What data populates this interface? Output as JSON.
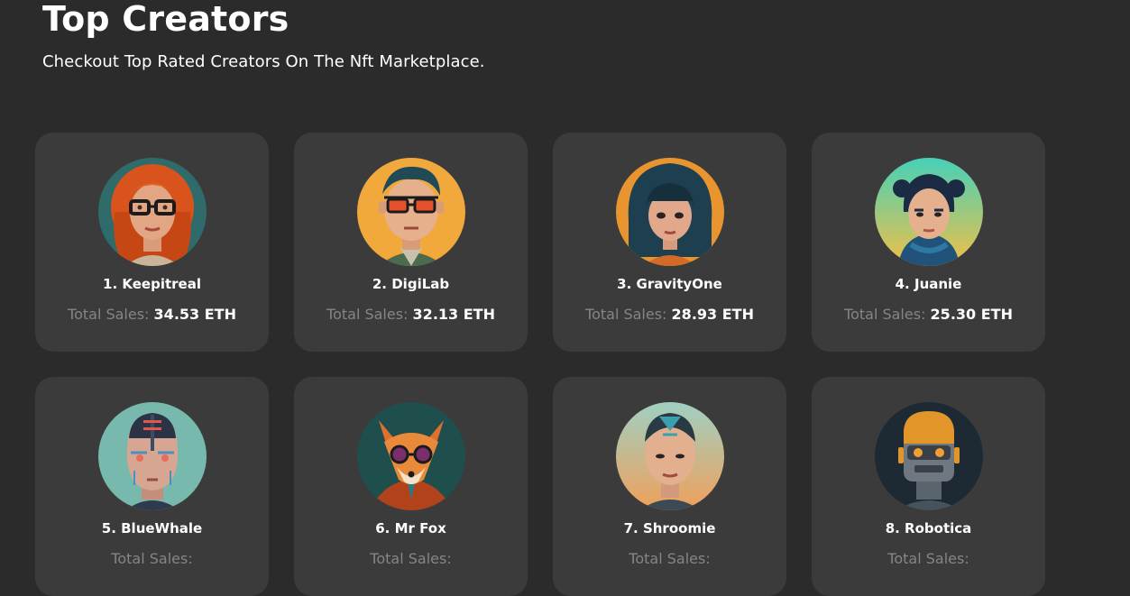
{
  "header": {
    "title": "Top Creators",
    "subtitle": "Checkout Top Rated Creators On The Nft Marketplace."
  },
  "creators": [
    {
      "name": "1. Keepitreal",
      "sales_label": "Total Sales:",
      "sales_value": "34.53 ETH",
      "avatar": "woman-red-hair-glasses-avatar",
      "bg": "#2f6b6a"
    },
    {
      "name": "2. DigiLab",
      "sales_label": "Total Sales:",
      "sales_value": "32.13 ETH",
      "avatar": "man-glasses-avatar",
      "bg": "#f0a93a"
    },
    {
      "name": "3. GravityOne",
      "sales_label": "Total Sales:",
      "sales_value": "28.93 ETH",
      "avatar": "woman-black-bob-avatar",
      "bg": "#e8952f"
    },
    {
      "name": "4. Juanie",
      "sales_label": "Total Sales:",
      "sales_value": "25.30 ETH",
      "avatar": "woman-blue-scarf-avatar",
      "bg": "#4fc9b4"
    },
    {
      "name": "5. BlueWhale",
      "sales_label": "Total Sales:",
      "sales_value": null,
      "avatar": "cyborg-face-avatar",
      "bg": "#78b9ad"
    },
    {
      "name": "6. Mr Fox",
      "sales_label": "Total Sales:",
      "sales_value": null,
      "avatar": "fox-sunglasses-avatar",
      "bg": "#1f4f4d"
    },
    {
      "name": "7. Shroomie",
      "sales_label": "Total Sales:",
      "sales_value": null,
      "avatar": "bald-man-tattoo-avatar",
      "bg": "#e9a06a"
    },
    {
      "name": "8. Robotica",
      "sales_label": "Total Sales:",
      "sales_value": null,
      "avatar": "robot-head-avatar",
      "bg": "#1d2a33"
    }
  ]
}
